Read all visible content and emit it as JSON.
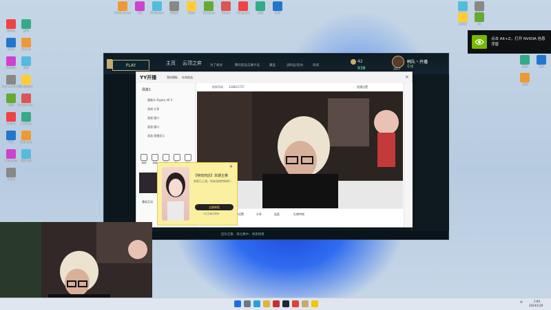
{
  "desktop_icons_top": [
    "Shadowplay",
    "QQ",
    "Wallpaper",
    "网易云",
    "Edge",
    "WeGame",
    "Steam",
    "Imagenie",
    "谷歌",
    "微信"
  ],
  "desktop_icons_left": [
    "回收站",
    "雷电",
    "Edge",
    "Smash",
    "QQ音乐",
    "网易",
    "Counter-Strike",
    "Wallpaper",
    "画图",
    "Dragons of...",
    "Firefox",
    "Lossless",
    "VLC",
    "Sunlogin",
    "Minecraft",
    "英雄联盟",
    "cheat"
  ],
  "desktop_icons_right": [
    "文件夹",
    "文件夹",
    "文件夹",
    "夜",
    "文件",
    "壁纸",
    "文档",
    "文档",
    "文档"
  ],
  "notification": {
    "text": "点击 Alt+Z，打开 NVIDIA 信息浮窗"
  },
  "game": {
    "play_label": "PLAY",
    "nav": [
      "主页",
      "云顶之弈"
    ],
    "nav_sub": [
      "为了峡谷",
      "腾讯新品与赛什设",
      "藏品",
      "战利品/造坊",
      "商城"
    ],
    "currency_rp": "42",
    "currency_be": "938",
    "profile_name": "韩队丶开播",
    "profile_sub": "在线",
    "level": "2617",
    "footer": "团队召集 · 排位赛中，谢谢观看"
  },
  "yy": {
    "logo": "YY开播",
    "title_tabs": [
      "我的模板",
      "在线收益"
    ],
    "topbar_left": "房间号码",
    "topbar_id": "228831757",
    "topbar_right": "直播设置",
    "scene": "场景1",
    "sources": [
      "摄像头-Elgato 4K X",
      "游戏·分享",
      "画面·窗口",
      "画面·窗口",
      "画面·直播显示"
    ],
    "tools": [
      "美颜",
      "绿幕",
      "游戏",
      "图片",
      "更多"
    ],
    "bottom_labels": [
      "互动游戏",
      "弹幕设置",
      "分享",
      "连麦",
      "礼物特效"
    ],
    "left_bottom": [
      "基础互动"
    ]
  },
  "popup": {
    "title": "【特效商店】本期主推",
    "desc": "商家已上线，快来选购特效吧～",
    "button": "立即体验",
    "note": "5位主播已使用"
  },
  "taskbar": {
    "time": "2:00",
    "date": "2024/1/20",
    "lang": "中"
  }
}
